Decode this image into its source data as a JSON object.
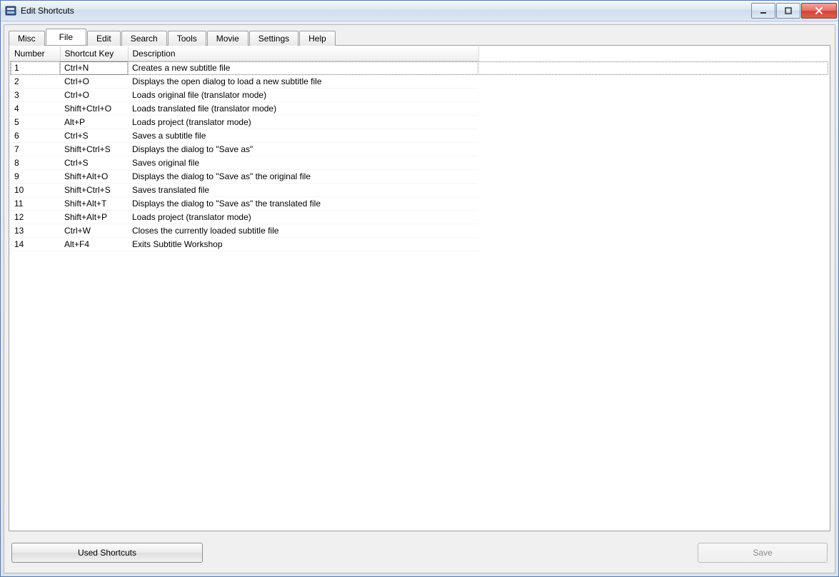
{
  "window": {
    "title": "Edit Shortcuts"
  },
  "tabs": [
    {
      "label": "Misc",
      "active": false
    },
    {
      "label": "File",
      "active": true
    },
    {
      "label": "Edit",
      "active": false
    },
    {
      "label": "Search",
      "active": false
    },
    {
      "label": "Tools",
      "active": false
    },
    {
      "label": "Movie",
      "active": false
    },
    {
      "label": "Settings",
      "active": false
    },
    {
      "label": "Help",
      "active": false
    }
  ],
  "columns": {
    "number": "Number",
    "shortcut": "Shortcut Key",
    "description": "Description"
  },
  "rows": [
    {
      "number": "1",
      "key": "Ctrl+N",
      "desc": "Creates a new subtitle file"
    },
    {
      "number": "2",
      "key": "Ctrl+O",
      "desc": "Displays the open dialog to load a new subtitle file"
    },
    {
      "number": "3",
      "key": "Ctrl+O",
      "desc": "Loads original file (translator mode)"
    },
    {
      "number": "4",
      "key": "Shift+Ctrl+O",
      "desc": "Loads translated file (translator mode)"
    },
    {
      "number": "5",
      "key": "Alt+P",
      "desc": "Loads project (translator mode)"
    },
    {
      "number": "6",
      "key": "Ctrl+S",
      "desc": "Saves a subtitle file"
    },
    {
      "number": "7",
      "key": "Shift+Ctrl+S",
      "desc": "Displays the dialog to \"Save as\""
    },
    {
      "number": "8",
      "key": "Ctrl+S",
      "desc": "Saves original file"
    },
    {
      "number": "9",
      "key": "Shift+Alt+O",
      "desc": "Displays the dialog to \"Save as\" the original file"
    },
    {
      "number": "10",
      "key": "Shift+Ctrl+S",
      "desc": "Saves translated file"
    },
    {
      "number": "11",
      "key": "Shift+Alt+T",
      "desc": "Displays the dialog to \"Save as\" the translated file"
    },
    {
      "number": "12",
      "key": "Shift+Alt+P",
      "desc": "Loads project (translator mode)"
    },
    {
      "number": "13",
      "key": "Ctrl+W",
      "desc": "Closes the currently loaded subtitle file"
    },
    {
      "number": "14",
      "key": "Alt+F4",
      "desc": "Exits Subtitle Workshop"
    }
  ],
  "buttons": {
    "used_shortcuts": "Used Shortcuts",
    "save": "Save"
  }
}
